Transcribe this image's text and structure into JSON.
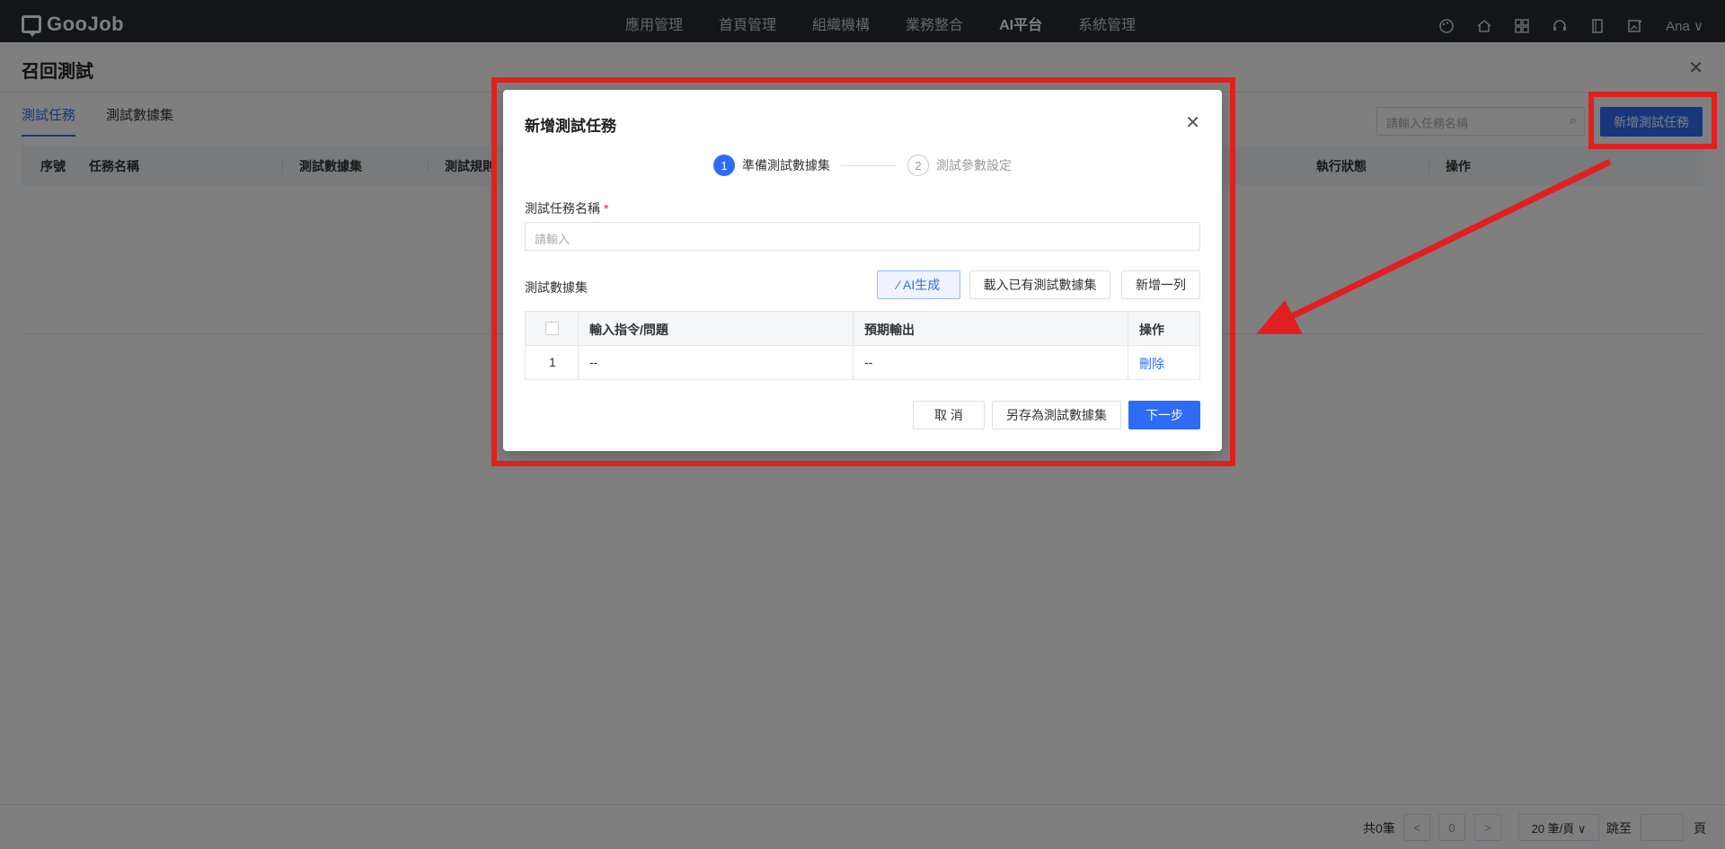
{
  "topbar": {
    "logo_text": "GooJob",
    "nav": [
      "應用管理",
      "首頁管理",
      "組織機構",
      "業務整合",
      "AI平台",
      "系統管理"
    ],
    "active_nav": "AI平台",
    "user": "Ana ∨"
  },
  "page": {
    "title": "召回測試",
    "tabs": [
      "測試任務",
      "測試數據集"
    ],
    "search_placeholder": "請輸入任務名稱",
    "add_button": "新增測試任務",
    "columns": [
      "序號",
      "任務名稱",
      "測試數據集",
      "測試規則",
      "執行狀態",
      "操作"
    ]
  },
  "footer": {
    "total": "共0筆",
    "prev": "<",
    "page": "0",
    "next": ">",
    "page_size": "20 筆/頁 ∨",
    "jump": "跳至",
    "page_unit": "頁"
  },
  "modal": {
    "title": "新增測試任務",
    "steps": [
      {
        "num": "1",
        "label": "準備測試數據集"
      },
      {
        "num": "2",
        "label": "測試參數設定"
      }
    ],
    "name_label": "測試任務名稱",
    "required_mark": "*",
    "name_placeholder": "請輸入",
    "dataset_label": "測試數據集",
    "ai_button": "AI生成",
    "load_button": "載入已有測試數據集",
    "add_row_button": "新增一列",
    "table_headers": [
      "輸入指令/問題",
      "預期輸出",
      "操作"
    ],
    "rows": [
      {
        "index": "1",
        "input": "--",
        "output": "--",
        "action": "刪除"
      }
    ],
    "cancel_button": "取 消",
    "save_button": "另存為測試數據集",
    "next_button": "下一步"
  },
  "colors": {
    "accent": "#2f6cf6",
    "annotation": "#e02020",
    "topbar": "#272b33"
  }
}
